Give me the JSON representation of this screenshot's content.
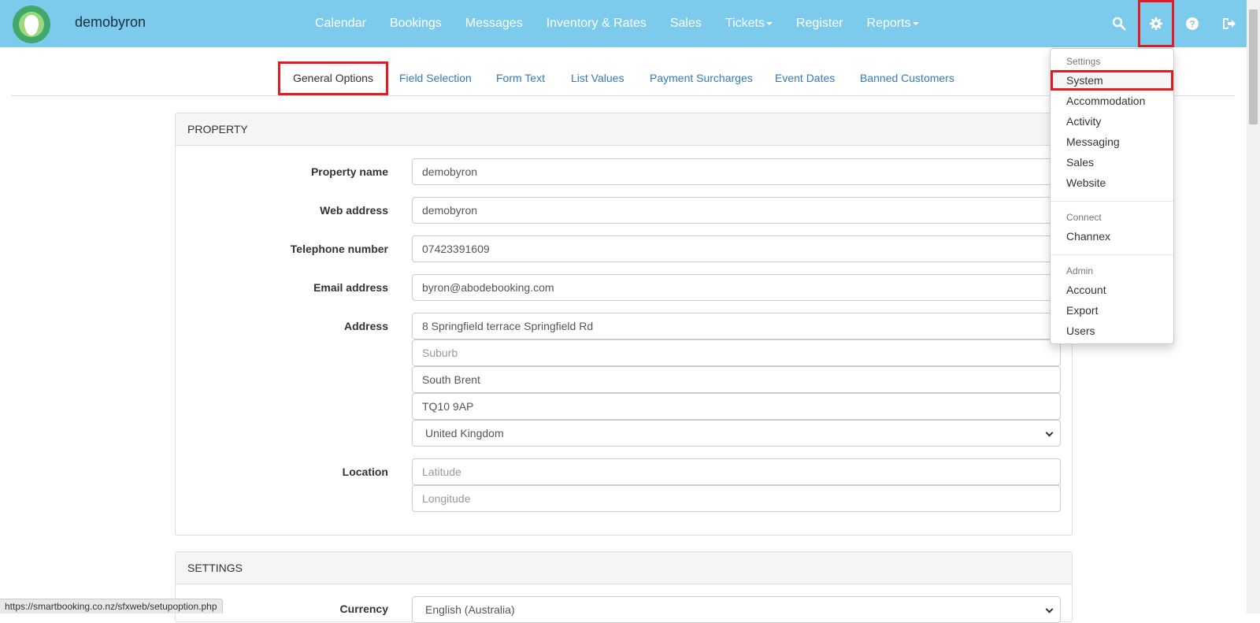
{
  "brand": {
    "name": "demobyron"
  },
  "nav": {
    "links": [
      {
        "label": "Calendar"
      },
      {
        "label": "Bookings"
      },
      {
        "label": "Messages"
      },
      {
        "label": "Inventory & Rates"
      },
      {
        "label": "Sales"
      },
      {
        "label": "Tickets"
      },
      {
        "label": "Register"
      },
      {
        "label": "Reports"
      }
    ],
    "icons": [
      "search-icon",
      "gear-icon",
      "help-icon",
      "logout-icon"
    ]
  },
  "subtabs": [
    {
      "label": "General Options"
    },
    {
      "label": "Field Selection"
    },
    {
      "label": "Form Text"
    },
    {
      "label": "List Values"
    },
    {
      "label": "Payment Surcharges"
    },
    {
      "label": "Event Dates"
    },
    {
      "label": "Banned Customers"
    }
  ],
  "property": {
    "heading": "PROPERTY",
    "property_name_label": "Property name",
    "property_name": "demobyron",
    "web_address_label": "Web address",
    "web_address": "demobyron",
    "telephone_label": "Telephone number",
    "telephone": "07423391609",
    "email_label": "Email address",
    "email": "byron@abodebooking.com",
    "address_label": "Address",
    "address_line1": "8 Springfield terrace Springfield Rd",
    "suburb_placeholder": "Suburb",
    "city": "South Brent",
    "postcode": "TQ10 9AP",
    "country": "United Kingdom",
    "location_label": "Location",
    "latitude_placeholder": "Latitude",
    "longitude_placeholder": "Longitude"
  },
  "settings": {
    "heading": "SETTINGS",
    "currency_label": "Currency",
    "currency": "English (Australia)"
  },
  "dropdown": {
    "settings_header": "Settings",
    "settings_items": [
      "System",
      "Accommodation",
      "Activity",
      "Messaging",
      "Sales",
      "Website"
    ],
    "connect_header": "Connect",
    "connect_items": [
      "Channex"
    ],
    "admin_header": "Admin",
    "admin_items": [
      "Account",
      "Export",
      "Users"
    ]
  },
  "status_url": "https://smartbooking.co.nz/sfxweb/setupoption.php",
  "colors": {
    "navbar": "#7ccbec",
    "highlight": "#e21c24",
    "link": "#337ab7"
  }
}
